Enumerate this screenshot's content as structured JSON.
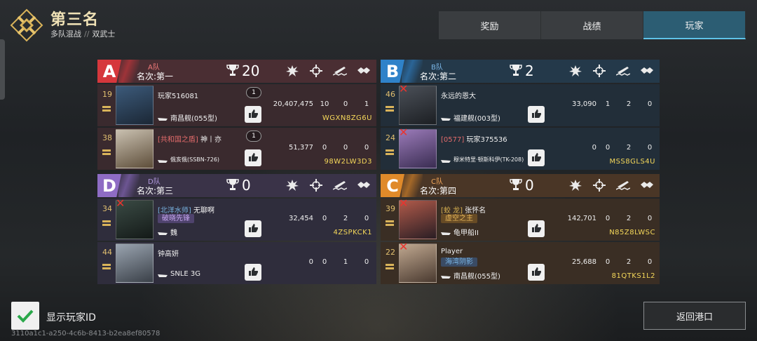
{
  "header": {
    "rank_title": "第三名",
    "mode": "多队混战",
    "mode_sep": "//",
    "sub_mode": "双武士"
  },
  "tabs": [
    {
      "label": "奖励",
      "active": false
    },
    {
      "label": "战绩",
      "active": false
    },
    {
      "label": "玩家",
      "active": true
    }
  ],
  "teams": {
    "A": {
      "letter": "A",
      "name": "A队",
      "place": "名次:第一",
      "score": "20",
      "colors": {
        "accent": "#d6373c",
        "head": "#4a2e33",
        "row": "#3a2a2e",
        "name": "#f07a7a"
      },
      "players": [
        {
          "level": "19",
          "name": "玩家516081",
          "guild": "",
          "title": "",
          "ship": "南昌舰(055型)",
          "kills_badge": "1",
          "damage": "20,407,475",
          "s1": "10",
          "s2": "0",
          "s3": "1",
          "id": "WGXN8ZG6U",
          "dead": false
        },
        {
          "level": "38",
          "name": "神丨亦",
          "guild": "[共和国之盾]",
          "title": "",
          "ship": "俄亥俄(SSBN-726)",
          "kills_badge": "1",
          "damage": "51,377",
          "s1": "0",
          "s2": "0",
          "s3": "0",
          "id": "98W2LW3D3",
          "dead": false
        }
      ]
    },
    "B": {
      "letter": "B",
      "name": "B队",
      "place": "名次:第二",
      "score": "2",
      "colors": {
        "accent": "#2f82c9",
        "head": "#24394a",
        "row": "#222e39",
        "name": "#7ab6e6"
      },
      "players": [
        {
          "level": "46",
          "name": "永远的恩大",
          "guild": "",
          "title": "",
          "ship": "福建舰(003型)",
          "kills_badge": "",
          "damage": "33,090",
          "s1": "1",
          "s2": "2",
          "s3": "0",
          "id": "",
          "dead": true
        },
        {
          "level": "24",
          "name": "玩家375536",
          "guild": "[0577]",
          "title": "",
          "ship": "穆米特里·顿斯科伊(TK-208)",
          "kills_badge": "",
          "damage": "0",
          "s1": "0",
          "s2": "2",
          "s3": "0",
          "id": "MSS8GLS4U",
          "dead": true
        }
      ]
    },
    "D": {
      "letter": "D",
      "name": "D队",
      "place": "名次:第三",
      "score": "0",
      "colors": {
        "accent": "#8e6cc4",
        "head": "#3a3348",
        "row": "#2f2d3c",
        "name": "#b39ae0"
      },
      "players": [
        {
          "level": "34",
          "name": "无聊啊",
          "guild": "[北洋水师]",
          "title": "破晓先锋",
          "ship": "魏",
          "kills_badge": "",
          "damage": "32,454",
          "s1": "0",
          "s2": "2",
          "s3": "0",
          "id": "4ZSPKCK1",
          "dead": true
        },
        {
          "level": "44",
          "name": "钟高妍",
          "guild": "",
          "title": "",
          "ship": "SNLE 3G",
          "kills_badge": "",
          "damage": "0",
          "s1": "0",
          "s2": "1",
          "s3": "0",
          "id": "",
          "dead": false
        }
      ]
    },
    "C": {
      "letter": "C",
      "name": "C队",
      "place": "名次:第四",
      "score": "0",
      "colors": {
        "accent": "#e08a2a",
        "head": "#4a3626",
        "row": "#3a2e24",
        "name": "#f0a65a"
      },
      "players": [
        {
          "level": "39",
          "name": "张怀名",
          "guild": "[蛟 龙]",
          "title": "虚空之主",
          "ship": "龟甲船II",
          "kills_badge": "",
          "damage": "142,701",
          "s1": "0",
          "s2": "2",
          "s3": "0",
          "id": "N85Z8LWSC",
          "dead": true
        },
        {
          "level": "22",
          "name": "Player",
          "guild": "",
          "title": "海湾阴影",
          "ship": "南昌舰(055型)",
          "kills_badge": "",
          "damage": "25,688",
          "s1": "0",
          "s2": "2",
          "s3": "0",
          "id": "81QTKS1L2",
          "dead": true
        }
      ]
    }
  },
  "footer": {
    "show_id_label": "显示玩家ID",
    "show_id_checked": true,
    "uid": "3110a1c1-a250-4c6b-8413-b2ea8ef80578",
    "back_label": "返回港口"
  }
}
